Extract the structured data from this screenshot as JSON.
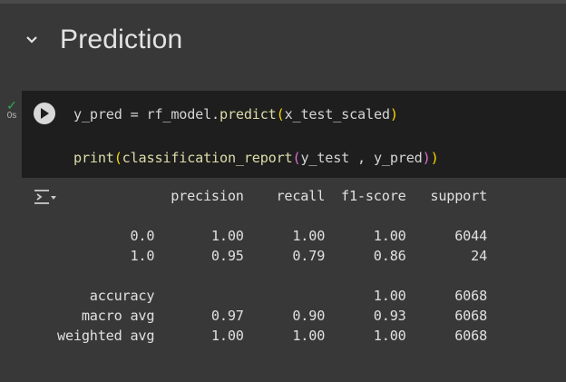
{
  "section": {
    "title": "Prediction",
    "icon": "chevron-down-icon"
  },
  "cell": {
    "status_icon": "check-icon",
    "exec_time": "0s",
    "run_icon": "play-icon",
    "code_line1": "y_pred = rf_model.predict(x_test_scaled)",
    "code_line2": "print(classification_report(y_test , y_pred))"
  },
  "output": {
    "icon": "output-actions-icon",
    "text": "              precision    recall  f1-score   support\n\n         0.0       1.00      1.00      1.00      6044\n         1.0       0.95      0.79      0.86        24\n\n    accuracy                           1.00      6068\n   macro avg       0.97      0.90      0.93      6068\nweighted avg       1.00      1.00      1.00      6068"
  },
  "colors": {
    "background": "#383838",
    "code_bg": "#1e1e1e",
    "function": "#dcdcaa",
    "paren_outer": "#ffd700",
    "paren_inner": "#da70d6",
    "success": "#34a853"
  }
}
